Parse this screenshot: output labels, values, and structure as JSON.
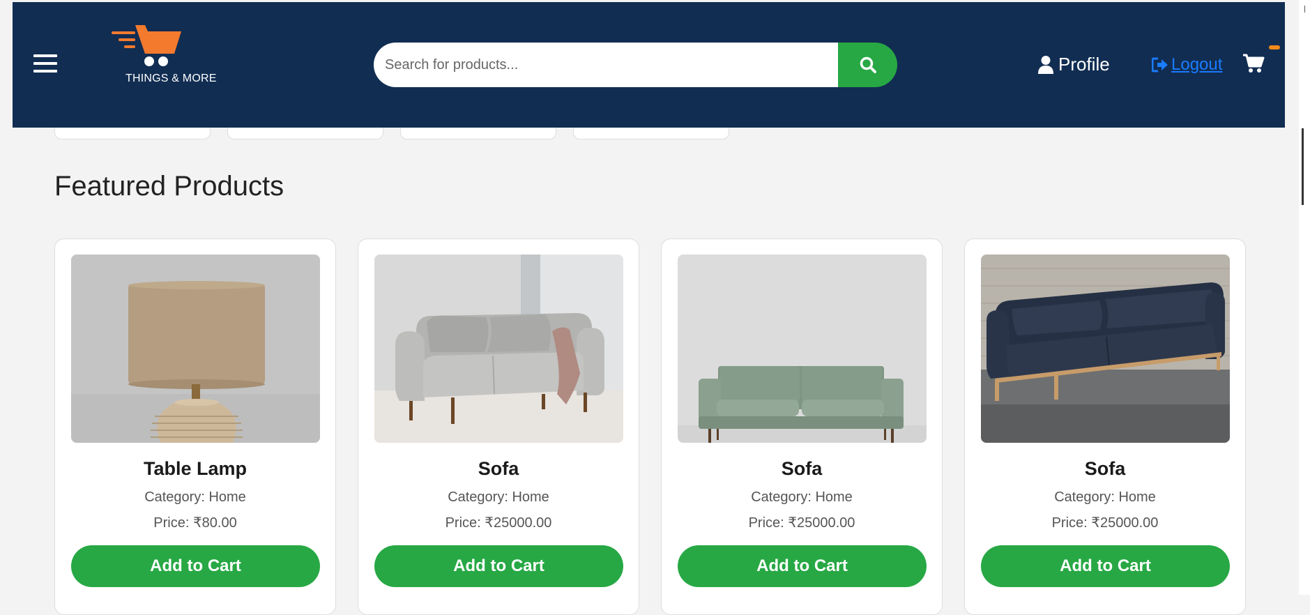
{
  "colors": {
    "header_bg": "#112d52",
    "accent_green": "#27a844",
    "logo_orange": "#f47a2e",
    "logout_blue": "#1a7cff",
    "page_bg": "#f3f3f3"
  },
  "header": {
    "menu_icon": "hamburger-icon",
    "logo": {
      "text": "THINGS & MORE",
      "icon": "shopping-cart-logo"
    },
    "search": {
      "placeholder": "Search for products...",
      "value": "",
      "button_icon": "search-icon"
    },
    "profile": {
      "label": "Profile",
      "icon": "user-icon"
    },
    "logout": {
      "label": " Logout",
      "icon": "sign-out-icon"
    },
    "cart": {
      "icon": "cart-icon"
    }
  },
  "main": {
    "section_title": "Featured Products",
    "products": [
      {
        "name": "Table Lamp",
        "category": "Category: Home",
        "price": "Price: ₹80.00",
        "button": "Add to Cart",
        "image": "table-lamp"
      },
      {
        "name": "Sofa",
        "category": "Category: Home",
        "price": "Price: ₹25000.00",
        "button": "Add to Cart",
        "image": "grey-sofa"
      },
      {
        "name": "Sofa",
        "category": "Category: Home",
        "price": "Price: ₹25000.00",
        "button": "Add to Cart",
        "image": "green-sofa"
      },
      {
        "name": "Sofa",
        "category": "Category: Home",
        "price": "Price: ₹25000.00",
        "button": "Add to Cart",
        "image": "navy-sofa"
      }
    ]
  }
}
